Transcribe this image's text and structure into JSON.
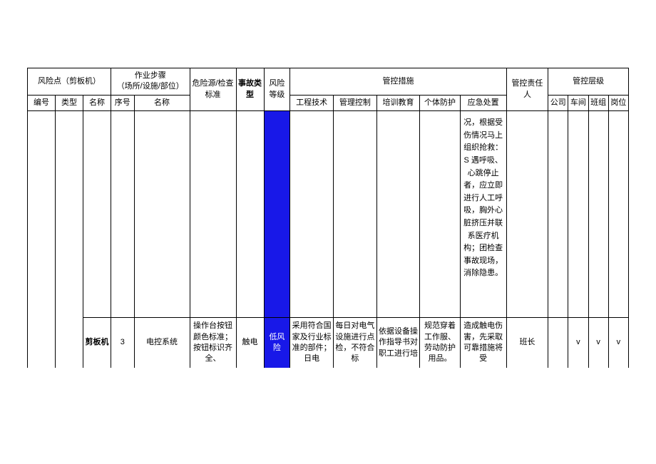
{
  "header": {
    "risk_point_group": "风险点（剪板机）",
    "work_step_group": "作业步骤\n（场所/设施/部位）",
    "hazard_source": "危险源/检查标准",
    "accident_type": "事故类型",
    "risk_level": "风险等级",
    "control_measures_group": "管控措施",
    "control_responsible": "管控责任人",
    "control_level_group": "管控层级",
    "id": "编号",
    "type": "类型",
    "name": "名称",
    "seq": "序号",
    "step_name": "名称",
    "eng_tech": "工程技术",
    "mgmt_ctrl": "管理控制",
    "training": "培训教育",
    "ppe": "个体防护",
    "emergency": "应急处置",
    "company": "公司",
    "workshop": "车间",
    "team": "班组",
    "post": "岗位"
  },
  "rows": {
    "upper": {
      "emergency": "况，根据受伤情况马上组织抢救：S 遇呼吸、心跳停止者，应立即进行人工呼吸，胸外心脏挤压并联系医疗机构；团检查事故现场，消除隐患。"
    },
    "lower": {
      "name": "剪板机",
      "seq": "3",
      "step_name": "电控系统",
      "hazard": "操作台按钮颜色标准；按钮标识齐全、",
      "accident": "触电",
      "risk_level": "低风险",
      "eng_tech": "采用符合国家及行业标准的部件；日电",
      "mgmt_ctrl": "每日对电气设施进行点检，不符合标",
      "training": "依据设备操作指导书对职工进行培",
      "ppe": "规范穿着工作服、劳动防护用品。",
      "emergency": "造成触电伤害，先采取可靠措施将受",
      "responsible": "班长",
      "workshop_chk": "v",
      "team_chk": "v",
      "post_chk": "v"
    }
  }
}
